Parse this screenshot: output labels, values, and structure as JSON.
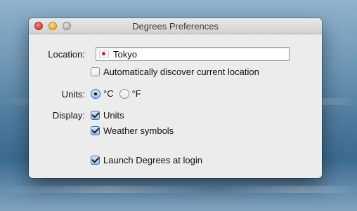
{
  "window": {
    "title": "Degrees Preferences"
  },
  "location": {
    "label": "Location:",
    "value": "Tokyo",
    "flag_icon": "japan-flag-icon",
    "auto_discover": {
      "label": "Automatically discover current location",
      "checked": false
    }
  },
  "units": {
    "label": "Units:",
    "options": [
      {
        "label": "°C",
        "selected": true
      },
      {
        "label": "°F",
        "selected": false
      }
    ]
  },
  "display": {
    "label": "Display:",
    "options": [
      {
        "label": "Units",
        "checked": true
      },
      {
        "label": "Weather symbols",
        "checked": true
      }
    ]
  },
  "launch_at_login": {
    "label": "Launch Degrees at login",
    "checked": true
  },
  "colors": {
    "accent": "#3f6fb6",
    "flag_red": "#d21e2b"
  }
}
